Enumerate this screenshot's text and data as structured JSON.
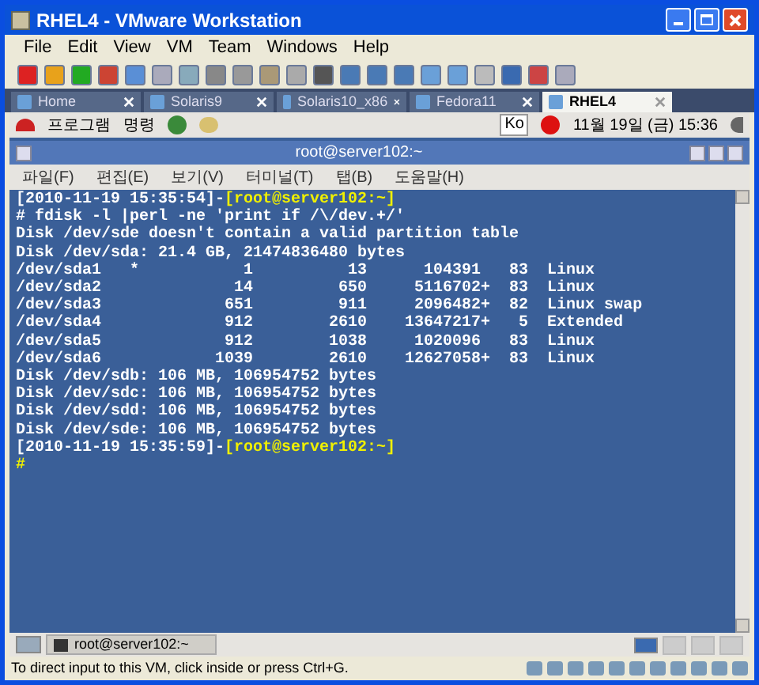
{
  "window": {
    "title": "RHEL4 - VMware Workstation"
  },
  "menu": [
    "File",
    "Edit",
    "View",
    "VM",
    "Team",
    "Windows",
    "Help"
  ],
  "tabs": [
    {
      "label": "Home",
      "selected": false
    },
    {
      "label": "Solaris9",
      "selected": false
    },
    {
      "label": "Solaris10_x86",
      "selected": false
    },
    {
      "label": "Fedora11",
      "selected": false
    },
    {
      "label": "RHEL4",
      "selected": true
    }
  ],
  "guest_panel": {
    "menus": [
      "프로그램",
      "명령"
    ],
    "input_method": "Ko",
    "clock": "11월 19일 (금) 15:36"
  },
  "terminal": {
    "title": "root@server102:~",
    "menu": [
      "파일(F)",
      "편집(E)",
      "보기(V)",
      "터미널(T)",
      "탭(B)",
      "도움말(H)"
    ],
    "lines": [
      {
        "kind": "prompt",
        "time": "[2010-11-19 15:35:54]-",
        "host": "[root@server102:~]"
      },
      {
        "kind": "output",
        "text": "# fdisk -l |perl -ne 'print if /\\/dev.+/'"
      },
      {
        "kind": "output",
        "text": "Disk /dev/sde doesn't contain a valid partition table"
      },
      {
        "kind": "output",
        "text": "Disk /dev/sda: 21.4 GB, 21474836480 bytes"
      },
      {
        "kind": "output",
        "text": "/dev/sda1   *           1          13      104391   83  Linux"
      },
      {
        "kind": "output",
        "text": "/dev/sda2              14         650     5116702+  83  Linux"
      },
      {
        "kind": "output",
        "text": "/dev/sda3             651         911     2096482+  82  Linux swap"
      },
      {
        "kind": "output",
        "text": "/dev/sda4             912        2610    13647217+   5  Extended"
      },
      {
        "kind": "output",
        "text": "/dev/sda5             912        1038     1020096   83  Linux"
      },
      {
        "kind": "output",
        "text": "/dev/sda6            1039        2610    12627058+  83  Linux"
      },
      {
        "kind": "output",
        "text": "Disk /dev/sdb: 106 MB, 106954752 bytes"
      },
      {
        "kind": "output",
        "text": "Disk /dev/sdc: 106 MB, 106954752 bytes"
      },
      {
        "kind": "output",
        "text": "Disk /dev/sdd: 106 MB, 106954752 bytes"
      },
      {
        "kind": "output",
        "text": "Disk /dev/sde: 106 MB, 106954752 bytes"
      },
      {
        "kind": "prompt",
        "time": "[2010-11-19 15:35:59]-",
        "host": "[root@server102:~]"
      },
      {
        "kind": "cursor",
        "text": "#"
      }
    ]
  },
  "guest_taskbar": {
    "task": "root@server102:~"
  },
  "status_bar": {
    "text": "To direct input to this VM, click inside or press Ctrl+G."
  }
}
